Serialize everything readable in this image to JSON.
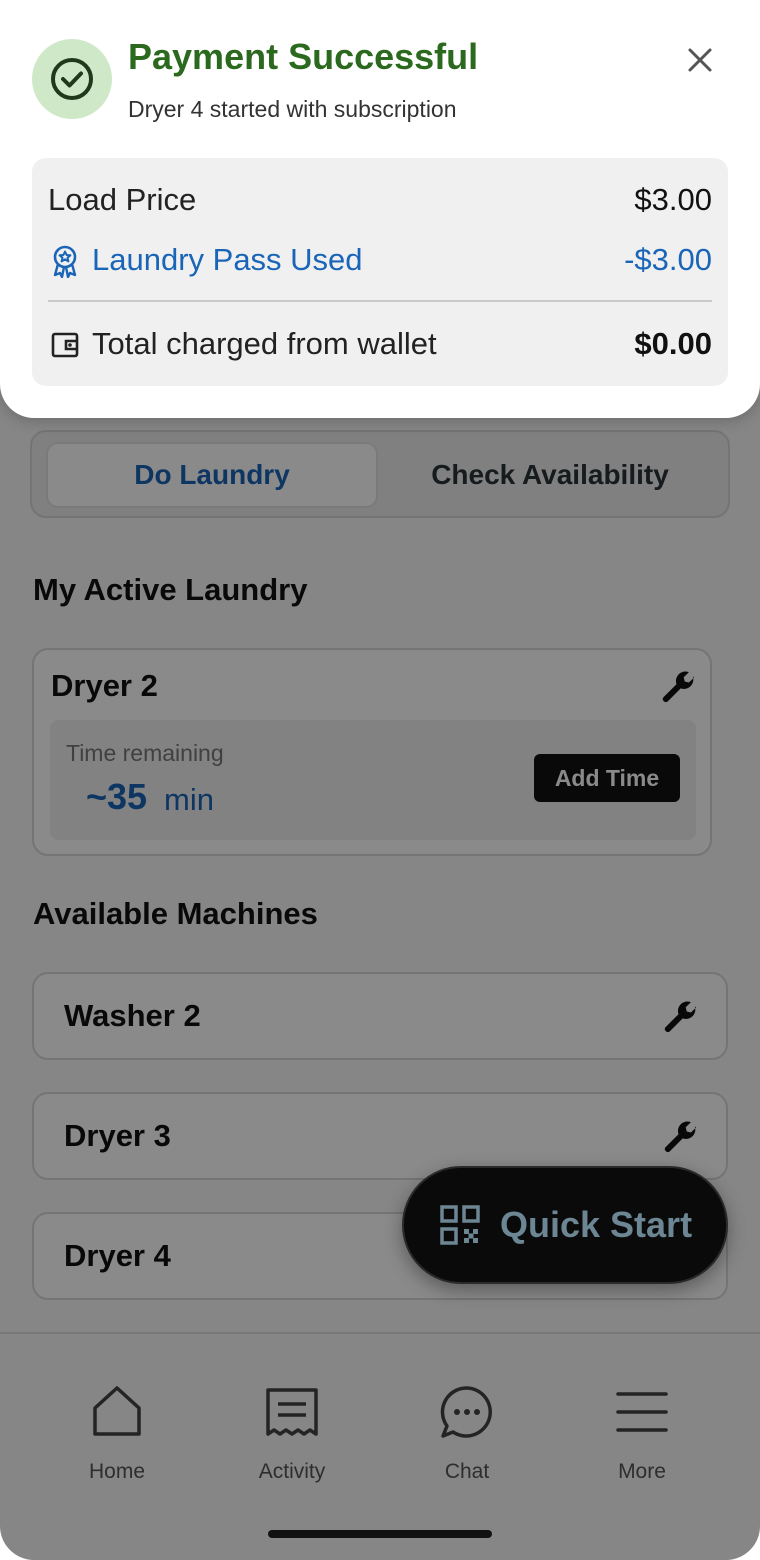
{
  "payment": {
    "title": "Payment Successful",
    "subtitle": "Dryer 4 started with subscription",
    "load_price_label": "Load Price",
    "load_price_value": "$3.00",
    "pass_label": "Laundry Pass Used",
    "pass_value": "-$3.00",
    "total_label": "Total charged from wallet",
    "total_value": "$0.00",
    "colors": {
      "success": "#2b6a1e",
      "link": "#1a65b7"
    }
  },
  "segmented": {
    "active_label": "Do Laundry",
    "inactive_label": "Check Availability"
  },
  "active_laundry": {
    "section_title": "My Active Laundry",
    "machine_name": "Dryer 2",
    "time_label": "Time remaining",
    "time_value": "~35",
    "time_unit": "min",
    "add_time_label": "Add Time"
  },
  "available": {
    "section_title": "Available Machines",
    "machines": [
      {
        "name": "Washer 2"
      },
      {
        "name": "Dryer 3"
      },
      {
        "name": "Dryer 4"
      }
    ]
  },
  "fab": {
    "label": "Quick Start",
    "icon": "qr-code-icon"
  },
  "tabbar": {
    "items": [
      {
        "label": "Home",
        "icon": "home-icon"
      },
      {
        "label": "Activity",
        "icon": "receipt-icon"
      },
      {
        "label": "Chat",
        "icon": "chat-icon"
      },
      {
        "label": "More",
        "icon": "menu-icon"
      }
    ]
  }
}
